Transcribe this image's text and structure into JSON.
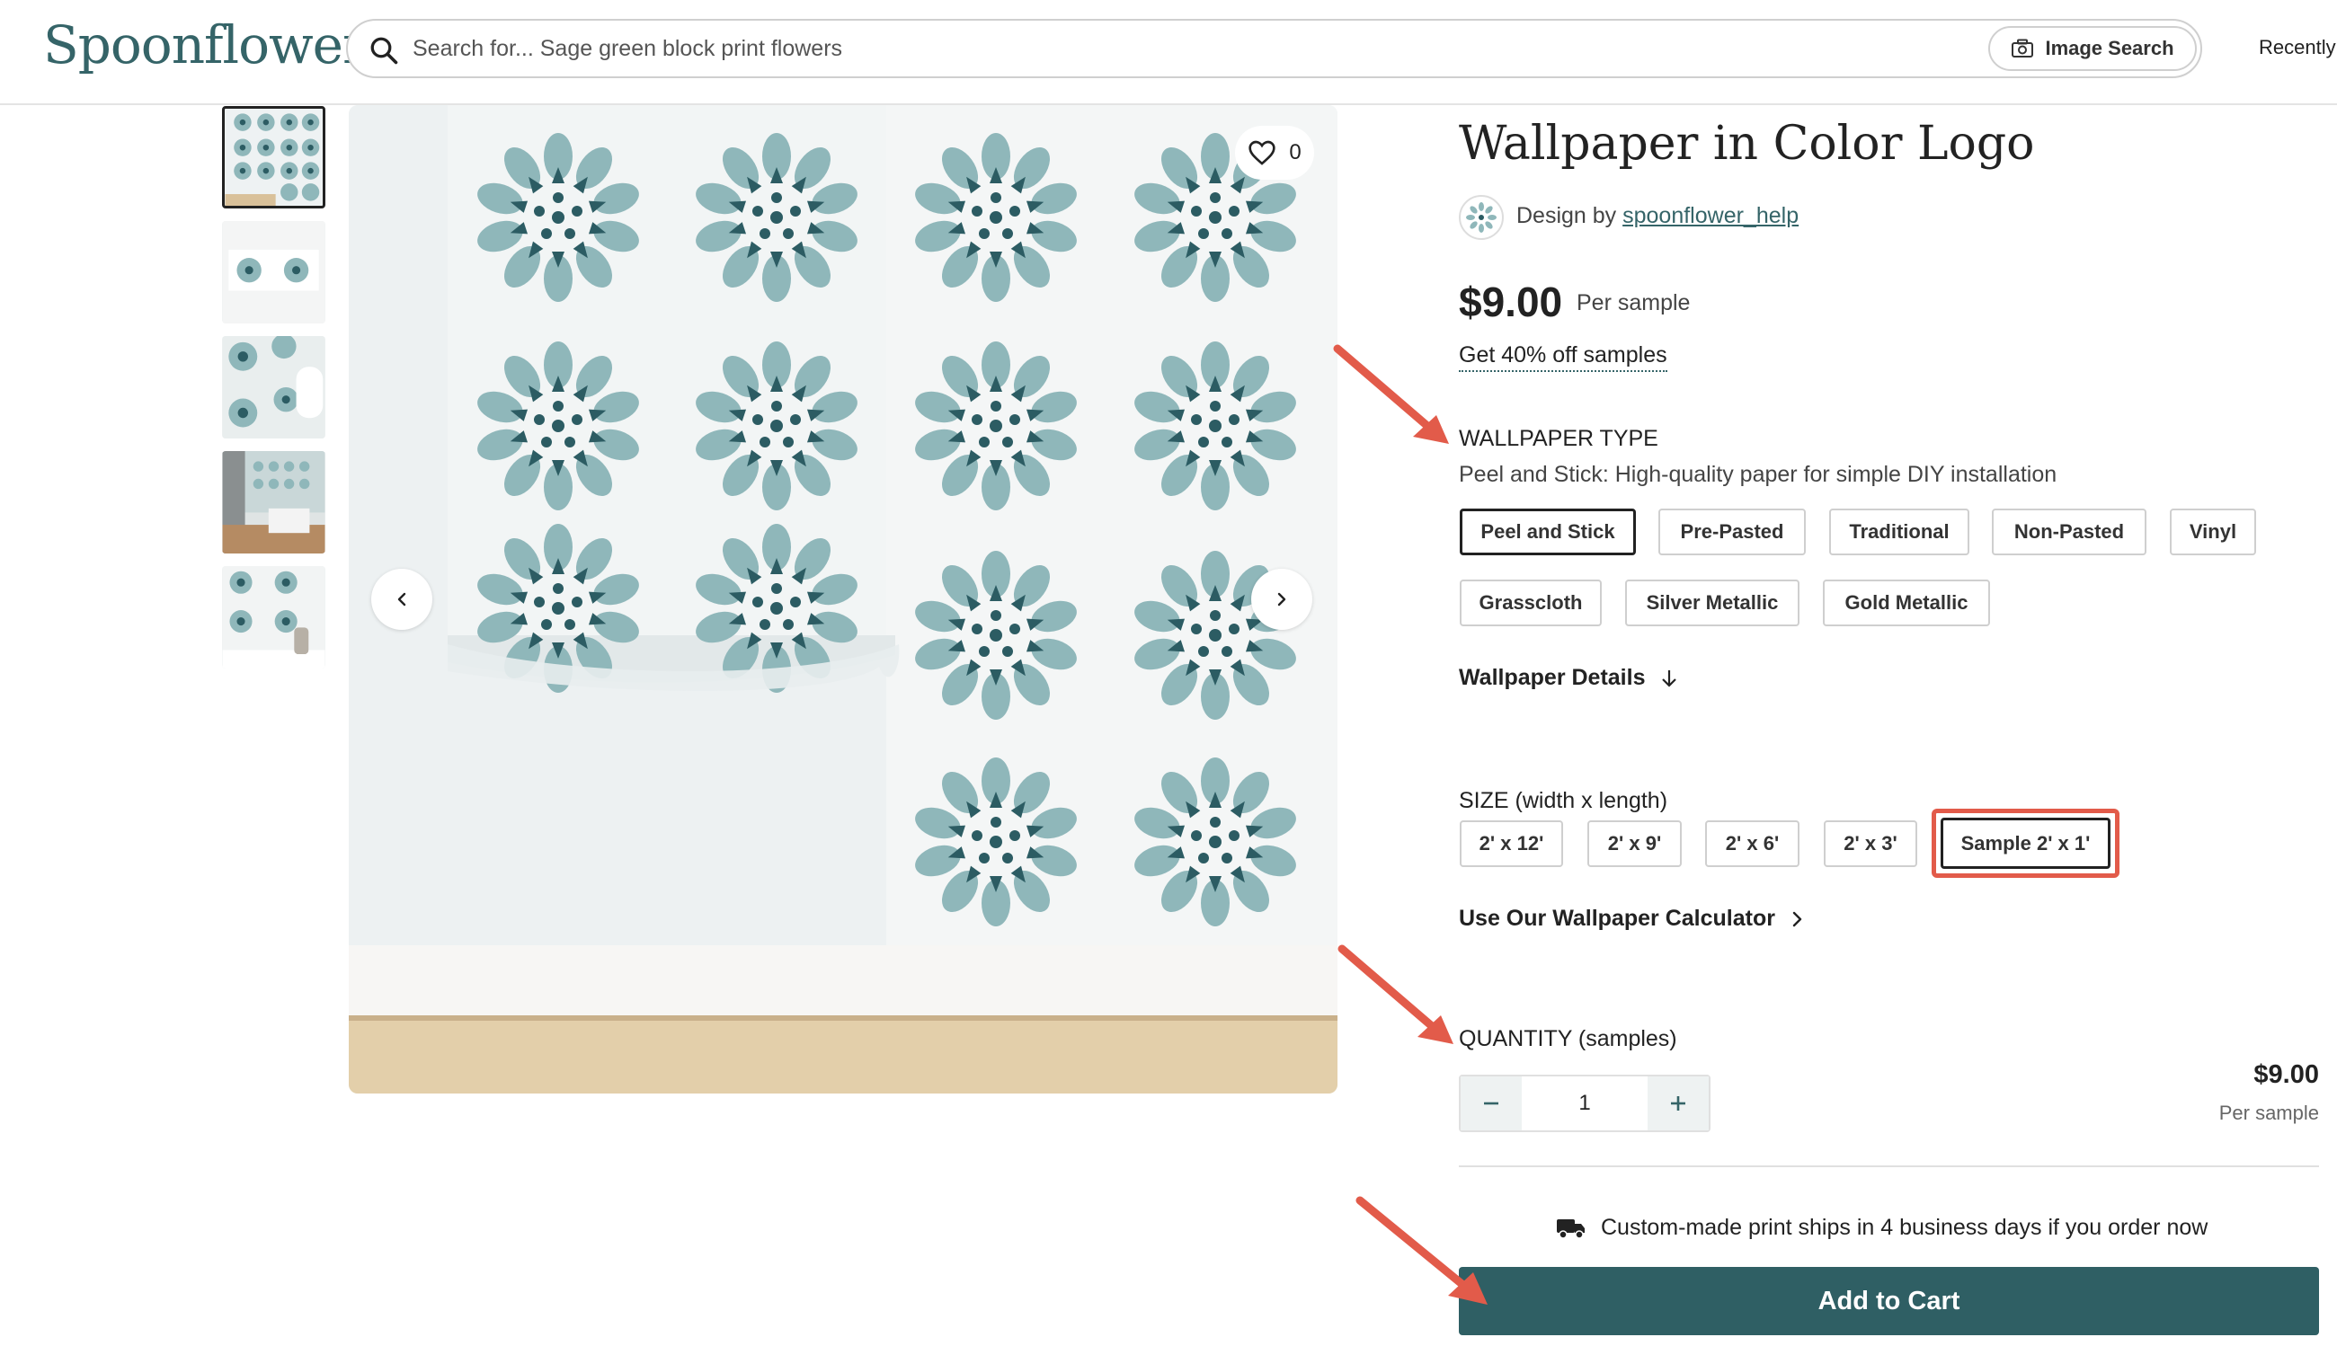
{
  "header": {
    "logo": "Spoonflower",
    "search_placeholder": "Search for... Sage green block print flowers",
    "image_search_label": "Image Search",
    "recently_label": "Recently"
  },
  "gallery": {
    "favorites_count": "0",
    "prev_icon": "chevron-left",
    "next_icon": "chevron-right"
  },
  "product": {
    "title": "Wallpaper in Color Logo",
    "design_by_label": "Design by",
    "designer": "spoonflower_help",
    "price": "$9.00",
    "price_unit": "Per sample",
    "discount_link": "Get 40% off samples",
    "wallpaper_type_label": "WALLPAPER TYPE",
    "wallpaper_type_desc": "Peel and Stick: High-quality paper for simple DIY installation",
    "wallpaper_types": [
      "Peel and Stick",
      "Pre-Pasted",
      "Traditional",
      "Non-Pasted",
      "Vinyl",
      "Grasscloth",
      "Silver Metallic",
      "Gold Metallic"
    ],
    "selected_type": "Peel and Stick",
    "details_link": "Wallpaper Details",
    "size_label": "SIZE (width x length)",
    "sizes": [
      "2' x 12'",
      "2' x 9'",
      "2' x 6'",
      "2' x 3'",
      "Sample 2' x 1'"
    ],
    "selected_size": "Sample 2' x 1'",
    "calculator_link": "Use Our Wallpaper Calculator",
    "quantity_label": "QUANTITY (samples)",
    "quantity": "1",
    "line_price": "$9.00",
    "line_unit": "Per sample",
    "shipping_note": "Custom-made print ships in 4 business days if you order now",
    "add_to_cart": "Add to Cart"
  },
  "colors": {
    "brand": "#356468",
    "button": "#2f5f64",
    "annotation": "#e25b4a",
    "pattern_light": "#8fb7ba",
    "pattern_dark": "#2c5c63"
  }
}
